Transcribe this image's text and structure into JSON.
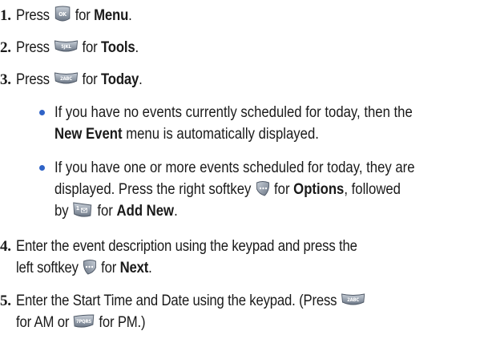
{
  "steps": [
    {
      "number": "1.",
      "before": "Press",
      "key": "menu-ok-key",
      "after": "for",
      "target": "Menu",
      "end": "."
    },
    {
      "number": "2.",
      "before": "Press",
      "key": "5-key",
      "after": "for",
      "target": "Tools",
      "end": "."
    },
    {
      "number": "3.",
      "before": "Press",
      "key": "2-key",
      "after": "for",
      "target": "Today",
      "end": "."
    },
    {
      "number": "4.",
      "line1": "Enter the event description using the keypad and press the",
      "line2_before": "left softkey",
      "line2_key": "left-softkey",
      "line2_after": "for",
      "line2_target": "Next",
      "line2_end": "."
    },
    {
      "number": "5.",
      "line1_before": "Enter the Start Time and Date using the keypad. (Press",
      "line1_key": "2-key",
      "line2_before": "for AM or",
      "line2_key": "7-key",
      "line2_after": "for PM.)"
    }
  ],
  "bullets": [
    {
      "line1": "If you have no events currently scheduled for today, then the",
      "line2_target": "New Event",
      "line2_after": "menu is automatically displayed."
    },
    {
      "line1": "If you have one or more events scheduled for today, they are",
      "line2_before": "displayed. Press the right softkey",
      "line2_key": "right-softkey",
      "line2_after": "for",
      "line2_target": "Options",
      "line2_end": ", followed",
      "line3_before": "by",
      "line3_key": "1-key",
      "line3_after": "for",
      "line3_target": "Add New",
      "line3_end": "."
    }
  ],
  "keys": {
    "menu_ok": "OK",
    "five": "5JKL",
    "two": "2ABC",
    "one": "1",
    "seven": "7PQRS"
  },
  "colors": {
    "bullet": "#2f63c7",
    "key_body": "#8a96a6"
  }
}
